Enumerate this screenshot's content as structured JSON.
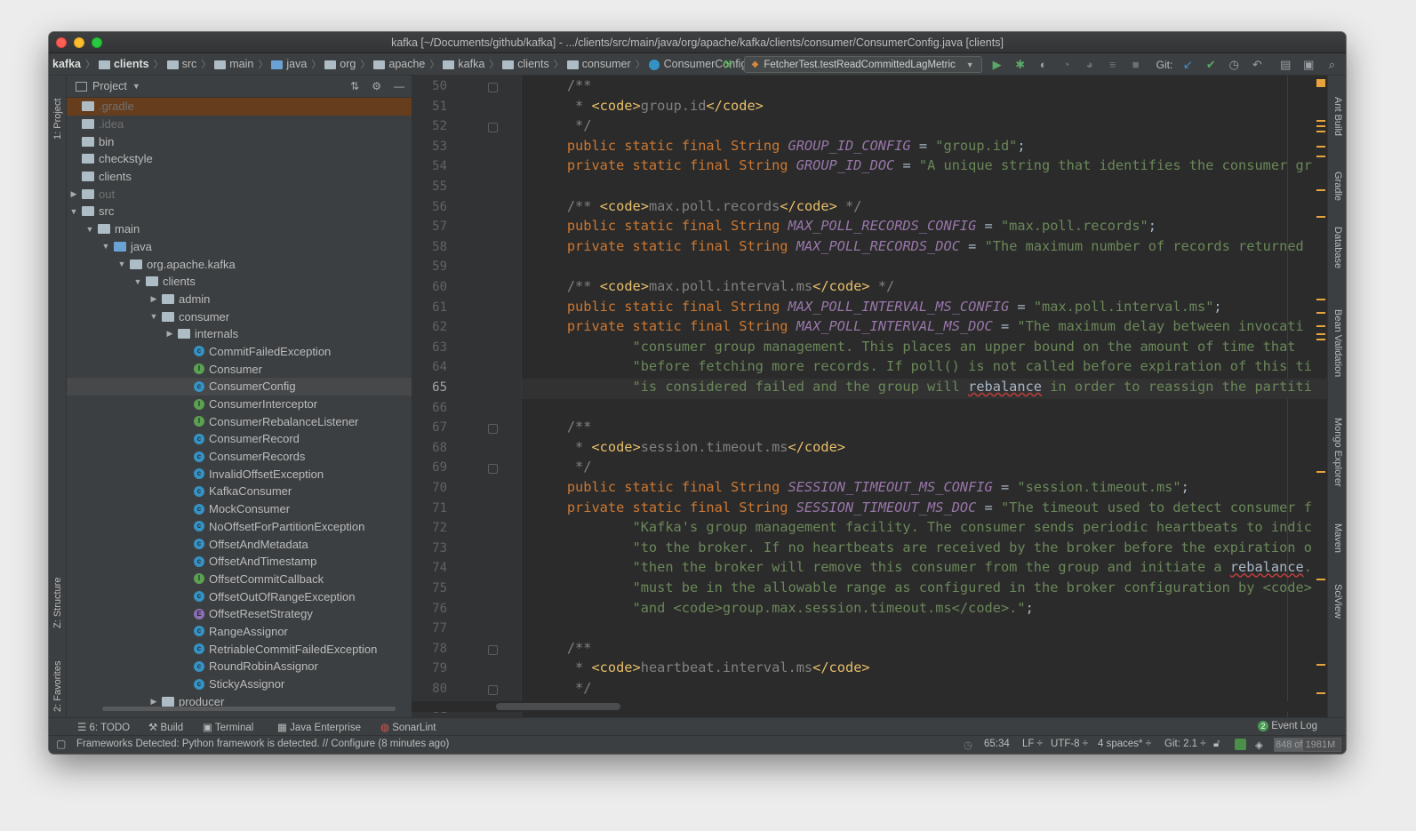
{
  "window": {
    "title": "kafka [~/Documents/github/kafka] - .../clients/src/main/java/org/apache/kafka/clients/consumer/ConsumerConfig.java [clients]"
  },
  "breadcrumb": [
    {
      "label": "kafka",
      "bold": true,
      "icon": "none"
    },
    {
      "label": "clients",
      "bold": true,
      "icon": "folder-icon"
    },
    {
      "label": "src",
      "bold": false,
      "icon": "folder-icon"
    },
    {
      "label": "main",
      "bold": false,
      "icon": "folder-icon"
    },
    {
      "label": "java",
      "bold": false,
      "icon": "folder-blue-icon"
    },
    {
      "label": "org",
      "bold": false,
      "icon": "package-icon"
    },
    {
      "label": "apache",
      "bold": false,
      "icon": "package-icon"
    },
    {
      "label": "kafka",
      "bold": false,
      "icon": "package-icon"
    },
    {
      "label": "clients",
      "bold": false,
      "icon": "package-icon"
    },
    {
      "label": "consumer",
      "bold": false,
      "icon": "package-icon"
    },
    {
      "label": "ConsumerConfig",
      "bold": false,
      "icon": "class-icon"
    }
  ],
  "toolbar": {
    "run_config": "FetcherTest.testReadCommittedLagMetric",
    "git_label": "Git:"
  },
  "project": {
    "header": "Project",
    "tree": [
      {
        "label": ".gradle",
        "depth": 0,
        "kind": "folder",
        "state": "highlight",
        "dim": true
      },
      {
        "label": ".idea",
        "depth": 0,
        "kind": "folder",
        "state": "",
        "dim": true
      },
      {
        "label": "bin",
        "depth": 0,
        "kind": "folder",
        "state": "",
        "dim": false
      },
      {
        "label": "checkstyle",
        "depth": 0,
        "kind": "folder",
        "state": "",
        "dim": false
      },
      {
        "label": "clients",
        "depth": 0,
        "kind": "folder",
        "state": "",
        "dim": false
      },
      {
        "label": "out",
        "depth": 0,
        "kind": "folder",
        "arrow": "right",
        "state": "",
        "dim": true
      },
      {
        "label": "src",
        "depth": 0,
        "kind": "folder",
        "arrow": "down",
        "state": "",
        "dim": false
      },
      {
        "label": "main",
        "depth": 1,
        "kind": "folder",
        "arrow": "down",
        "state": "",
        "dim": false
      },
      {
        "label": "java",
        "depth": 2,
        "kind": "folder-blue",
        "arrow": "down",
        "state": "",
        "dim": false
      },
      {
        "label": "org.apache.kafka",
        "depth": 3,
        "kind": "package",
        "arrow": "down",
        "state": "",
        "dim": false
      },
      {
        "label": "clients",
        "depth": 4,
        "kind": "package",
        "arrow": "down",
        "state": "",
        "dim": false
      },
      {
        "label": "admin",
        "depth": 5,
        "kind": "package",
        "arrow": "right",
        "state": "",
        "dim": false
      },
      {
        "label": "consumer",
        "depth": 5,
        "kind": "package",
        "arrow": "down",
        "state": "",
        "dim": false
      },
      {
        "label": "internals",
        "depth": 6,
        "kind": "package",
        "arrow": "right",
        "state": "",
        "dim": false
      },
      {
        "label": "CommitFailedException",
        "depth": 7,
        "kind": "class",
        "state": "",
        "dim": false
      },
      {
        "label": "Consumer",
        "depth": 7,
        "kind": "interface",
        "state": "",
        "dim": false
      },
      {
        "label": "ConsumerConfig",
        "depth": 7,
        "kind": "class",
        "state": "selected",
        "dim": false
      },
      {
        "label": "ConsumerInterceptor",
        "depth": 7,
        "kind": "interface",
        "state": "",
        "dim": false
      },
      {
        "label": "ConsumerRebalanceListener",
        "depth": 7,
        "kind": "interface",
        "state": "",
        "dim": false
      },
      {
        "label": "ConsumerRecord",
        "depth": 7,
        "kind": "class",
        "state": "",
        "dim": false
      },
      {
        "label": "ConsumerRecords",
        "depth": 7,
        "kind": "class",
        "state": "",
        "dim": false
      },
      {
        "label": "InvalidOffsetException",
        "depth": 7,
        "kind": "class",
        "state": "",
        "dim": false
      },
      {
        "label": "KafkaConsumer",
        "depth": 7,
        "kind": "class",
        "state": "",
        "dim": false
      },
      {
        "label": "MockConsumer",
        "depth": 7,
        "kind": "class",
        "state": "",
        "dim": false
      },
      {
        "label": "NoOffsetForPartitionException",
        "depth": 7,
        "kind": "class",
        "state": "",
        "dim": false
      },
      {
        "label": "OffsetAndMetadata",
        "depth": 7,
        "kind": "class",
        "state": "",
        "dim": false
      },
      {
        "label": "OffsetAndTimestamp",
        "depth": 7,
        "kind": "class",
        "state": "",
        "dim": false
      },
      {
        "label": "OffsetCommitCallback",
        "depth": 7,
        "kind": "interface",
        "state": "",
        "dim": false
      },
      {
        "label": "OffsetOutOfRangeException",
        "depth": 7,
        "kind": "class",
        "state": "",
        "dim": false
      },
      {
        "label": "OffsetResetStrategy",
        "depth": 7,
        "kind": "enum",
        "state": "",
        "dim": false
      },
      {
        "label": "RangeAssignor",
        "depth": 7,
        "kind": "class",
        "state": "",
        "dim": false
      },
      {
        "label": "RetriableCommitFailedException",
        "depth": 7,
        "kind": "class",
        "state": "",
        "dim": false
      },
      {
        "label": "RoundRobinAssignor",
        "depth": 7,
        "kind": "class",
        "state": "",
        "dim": false
      },
      {
        "label": "StickyAssignor",
        "depth": 7,
        "kind": "class",
        "state": "",
        "dim": false
      },
      {
        "label": "producer",
        "depth": 5,
        "kind": "package",
        "arrow": "right",
        "state": "",
        "dim": false
      }
    ]
  },
  "left_tool_windows": [
    "1: Project",
    "Z: Structure",
    "2: Favorites"
  ],
  "right_tool_windows": [
    "Ant Build",
    "Gradle",
    "Database",
    "Bean Validation",
    "Mongo Explorer",
    "Maven",
    "SciView"
  ],
  "editor": {
    "current_line": 65,
    "lines": [
      {
        "n": 50,
        "fold": true,
        "segs": [
          [
            "cm",
            "    /**"
          ]
        ]
      },
      {
        "n": 51,
        "segs": [
          [
            "cm",
            "     * "
          ],
          [
            "tag",
            "<code>"
          ],
          [
            "cm",
            "group.id"
          ],
          [
            "tag",
            "</code>"
          ]
        ]
      },
      {
        "n": 52,
        "fold": true,
        "segs": [
          [
            "cm",
            "     */"
          ]
        ]
      },
      {
        "n": 53,
        "segs": [
          [
            "kw",
            "    public static final "
          ],
          [
            "ty",
            "String "
          ],
          [
            "cn",
            "GROUP_ID_CONFIG"
          ],
          [
            "plain",
            " = "
          ],
          [
            "st",
            "\"group.id\""
          ],
          [
            "plain",
            ";"
          ]
        ]
      },
      {
        "n": 54,
        "segs": [
          [
            "kw",
            "    private static final "
          ],
          [
            "ty",
            "String "
          ],
          [
            "cn",
            "GROUP_ID_DOC"
          ],
          [
            "plain",
            " = "
          ],
          [
            "st",
            "\"A unique string that identifies the consumer gr"
          ]
        ]
      },
      {
        "n": 55,
        "segs": []
      },
      {
        "n": 56,
        "segs": [
          [
            "cm",
            "    /** "
          ],
          [
            "tag",
            "<code>"
          ],
          [
            "cm",
            "max.poll.records"
          ],
          [
            "tag",
            "</code>"
          ],
          [
            "cm",
            " */"
          ]
        ]
      },
      {
        "n": 57,
        "segs": [
          [
            "kw",
            "    public static final "
          ],
          [
            "ty",
            "String "
          ],
          [
            "cn",
            "MAX_POLL_RECORDS_CONFIG"
          ],
          [
            "plain",
            " = "
          ],
          [
            "st",
            "\"max.poll.records\""
          ],
          [
            "plain",
            ";"
          ]
        ]
      },
      {
        "n": 58,
        "segs": [
          [
            "kw",
            "    private static final "
          ],
          [
            "ty",
            "String "
          ],
          [
            "cn",
            "MAX_POLL_RECORDS_DOC"
          ],
          [
            "plain",
            " = "
          ],
          [
            "st",
            "\"The maximum number of records returned"
          ]
        ]
      },
      {
        "n": 59,
        "segs": []
      },
      {
        "n": 60,
        "segs": [
          [
            "cm",
            "    /** "
          ],
          [
            "tag",
            "<code>"
          ],
          [
            "cm",
            "max.poll.interval.ms"
          ],
          [
            "tag",
            "</code>"
          ],
          [
            "cm",
            " */"
          ]
        ]
      },
      {
        "n": 61,
        "segs": [
          [
            "kw",
            "    public static final "
          ],
          [
            "ty",
            "String "
          ],
          [
            "cn",
            "MAX_POLL_INTERVAL_MS_CONFIG"
          ],
          [
            "plain",
            " = "
          ],
          [
            "st",
            "\"max.poll.interval.ms\""
          ],
          [
            "plain",
            ";"
          ]
        ]
      },
      {
        "n": 62,
        "segs": [
          [
            "kw",
            "    private static final "
          ],
          [
            "ty",
            "String "
          ],
          [
            "cn",
            "MAX_POLL_INTERVAL_MS_DOC"
          ],
          [
            "plain",
            " = "
          ],
          [
            "st",
            "\"The maximum delay between invocati"
          ]
        ]
      },
      {
        "n": 63,
        "segs": [
          [
            "st",
            "            \"consumer group management. This places an upper bound on the amount of time that "
          ]
        ]
      },
      {
        "n": 64,
        "segs": [
          [
            "st",
            "            \"before fetching more records. If poll() is not called before expiration of this ti"
          ]
        ]
      },
      {
        "n": 65,
        "segs": [
          [
            "st",
            "            \"is considered failed and the group will "
          ],
          [
            "sq",
            "rebalance"
          ],
          [
            "st",
            " in order to reassign the partiti"
          ]
        ]
      },
      {
        "n": 66,
        "segs": []
      },
      {
        "n": 67,
        "fold": true,
        "segs": [
          [
            "cm",
            "    /**"
          ]
        ]
      },
      {
        "n": 68,
        "segs": [
          [
            "cm",
            "     * "
          ],
          [
            "tag",
            "<code>"
          ],
          [
            "cm",
            "session.timeout.ms"
          ],
          [
            "tag",
            "</code>"
          ]
        ]
      },
      {
        "n": 69,
        "fold": true,
        "segs": [
          [
            "cm",
            "     */"
          ]
        ]
      },
      {
        "n": 70,
        "segs": [
          [
            "kw",
            "    public static final "
          ],
          [
            "ty",
            "String "
          ],
          [
            "cn",
            "SESSION_TIMEOUT_MS_CONFIG"
          ],
          [
            "plain",
            " = "
          ],
          [
            "st",
            "\"session.timeout.ms\""
          ],
          [
            "plain",
            ";"
          ]
        ]
      },
      {
        "n": 71,
        "segs": [
          [
            "kw",
            "    private static final "
          ],
          [
            "ty",
            "String "
          ],
          [
            "cn",
            "SESSION_TIMEOUT_MS_DOC"
          ],
          [
            "plain",
            " = "
          ],
          [
            "st",
            "\"The timeout used to detect consumer f"
          ]
        ]
      },
      {
        "n": 72,
        "segs": [
          [
            "st",
            "            \"Kafka's group management facility. The consumer sends periodic heartbeats to indic"
          ]
        ]
      },
      {
        "n": 73,
        "segs": [
          [
            "st",
            "            \"to the broker. If no heartbeats are received by the broker before the expiration o"
          ]
        ]
      },
      {
        "n": 74,
        "segs": [
          [
            "st",
            "            \"then the broker will remove this consumer from the group and initiate a "
          ],
          [
            "sq",
            "rebalance"
          ],
          [
            "st",
            "."
          ]
        ]
      },
      {
        "n": 75,
        "segs": [
          [
            "st",
            "            \"must be in the allowable range as configured in the broker configuration by <code>"
          ]
        ]
      },
      {
        "n": 76,
        "segs": [
          [
            "st",
            "            \"and <code>group.max.session.timeout.ms</code>.\""
          ],
          [
            "plain",
            ";"
          ]
        ]
      },
      {
        "n": 77,
        "segs": []
      },
      {
        "n": 78,
        "fold": true,
        "segs": [
          [
            "cm",
            "    /**"
          ]
        ]
      },
      {
        "n": 79,
        "segs": [
          [
            "cm",
            "     * "
          ],
          [
            "tag",
            "<code>"
          ],
          [
            "cm",
            "heartbeat.interval.ms"
          ],
          [
            "tag",
            "</code>"
          ]
        ]
      },
      {
        "n": 80,
        "fold": true,
        "segs": [
          [
            "cm",
            "     */"
          ]
        ]
      },
      {
        "n": 81,
        "segs": []
      }
    ]
  },
  "bottom_tabs": [
    {
      "label": "6: TODO",
      "icon": "list-icon"
    },
    {
      "label": "Build",
      "icon": "hammer-icon"
    },
    {
      "label": "Terminal",
      "icon": "terminal-icon"
    },
    {
      "label": "Java Enterprise",
      "icon": "enterprise-icon"
    },
    {
      "label": "SonarLint",
      "icon": "sonarlint-icon"
    }
  ],
  "event_log": {
    "label": "Event Log",
    "count": "2"
  },
  "status": {
    "message": "Frameworks Detected: Python framework is detected. // Configure (8 minutes ago)",
    "position": "65:34",
    "line_sep": "LF ÷",
    "encoding": "UTF-8 ÷",
    "indent": "4 spaces* ÷",
    "git": "Git: 2.1 ÷",
    "memory": "848 of 1981M",
    "memory_fraction": 0.43
  },
  "colors": {
    "keyword": "#cc7832",
    "constant": "#9876aa",
    "string": "#6a8759",
    "comment": "#808080",
    "doc_tag": "#e8bf6a"
  }
}
